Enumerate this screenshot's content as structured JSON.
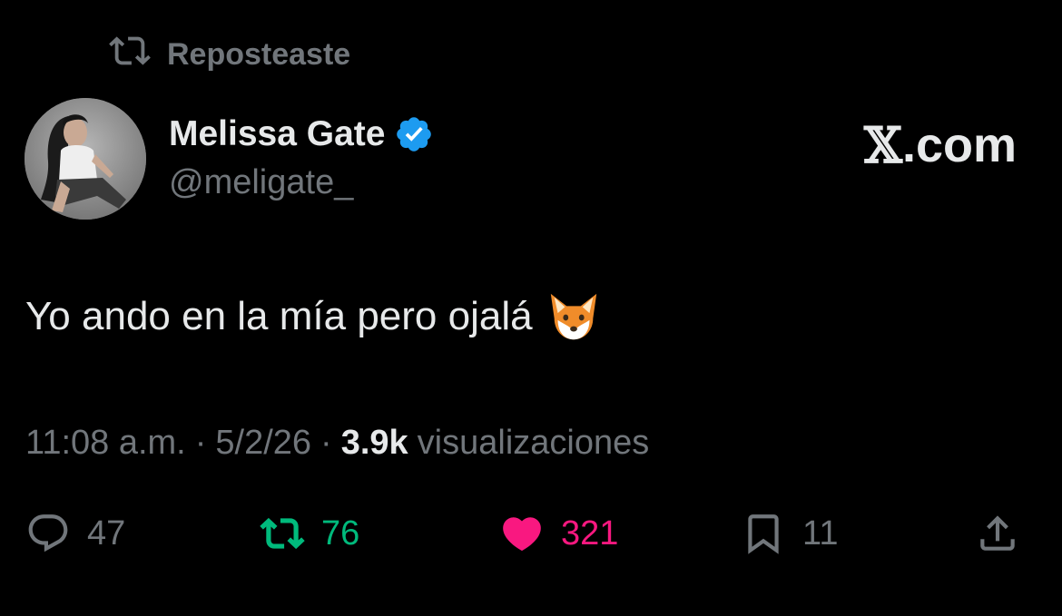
{
  "context": {
    "icon": "repost-icon",
    "label": "Reposteaste"
  },
  "author": {
    "display_name": "Melissa Gate",
    "handle": "@meligate_",
    "verified": true,
    "verified_color": "#1d9bf0"
  },
  "brand": {
    "x_mark": "𝕏",
    "suffix": ".com"
  },
  "tweet": {
    "text": "Yo ando en la mía pero ojalá",
    "emoji": "fox-face-emoji"
  },
  "meta": {
    "time": "11:08 a.m.",
    "separator": "·",
    "date": "5/2/26",
    "views_count": "3.9k",
    "views_label": "visualizaciones"
  },
  "actions": {
    "replies": "47",
    "reposts": "76",
    "likes": "321",
    "bookmarks": "11"
  },
  "colors": {
    "background": "#000000",
    "text_primary": "#e7e9ea",
    "text_secondary": "#71767b",
    "repost_active": "#00ba7c",
    "like_active": "#f91880"
  }
}
